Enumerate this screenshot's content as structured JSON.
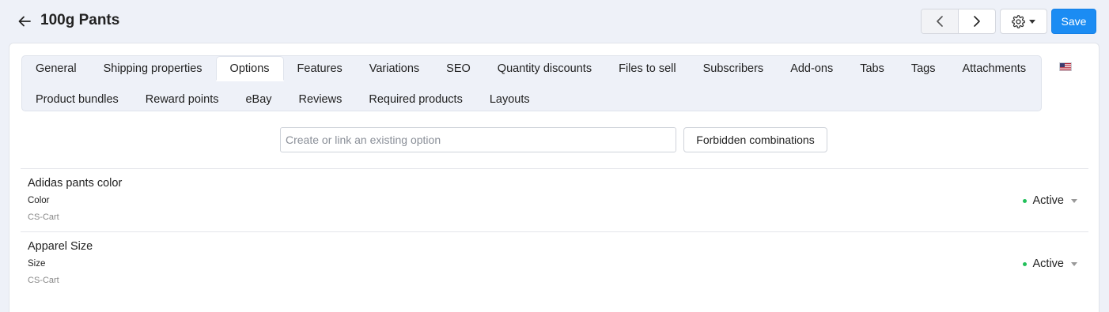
{
  "header": {
    "title": "100g Pants",
    "save_label": "Save"
  },
  "tabs": {
    "row1": [
      "General",
      "Shipping properties",
      "Options",
      "Features",
      "Variations",
      "SEO",
      "Quantity discounts",
      "Files to sell",
      "Subscribers",
      "Add-ons",
      "Tabs",
      "Tags",
      "Attachments"
    ],
    "row2": [
      "Product bundles",
      "Reward points",
      "eBay",
      "Reviews",
      "Required products",
      "Layouts"
    ],
    "active": "Options"
  },
  "options_toolbar": {
    "search_placeholder": "Create or link an existing option",
    "forbidden_label": "Forbidden combinations"
  },
  "options": [
    {
      "name": "Adidas pants color",
      "type": "Color",
      "owner": "CS-Cart",
      "status": "Active"
    },
    {
      "name": "Apparel Size",
      "type": "Size",
      "owner": "CS-Cart",
      "status": "Active"
    }
  ],
  "colors": {
    "accent": "#1b8cf3",
    "status_active": "#22c05a"
  },
  "icons": [
    "back-arrow-icon",
    "chevron-left-icon",
    "chevron-right-icon",
    "gear-icon",
    "caret-down-icon",
    "us-flag-icon"
  ]
}
